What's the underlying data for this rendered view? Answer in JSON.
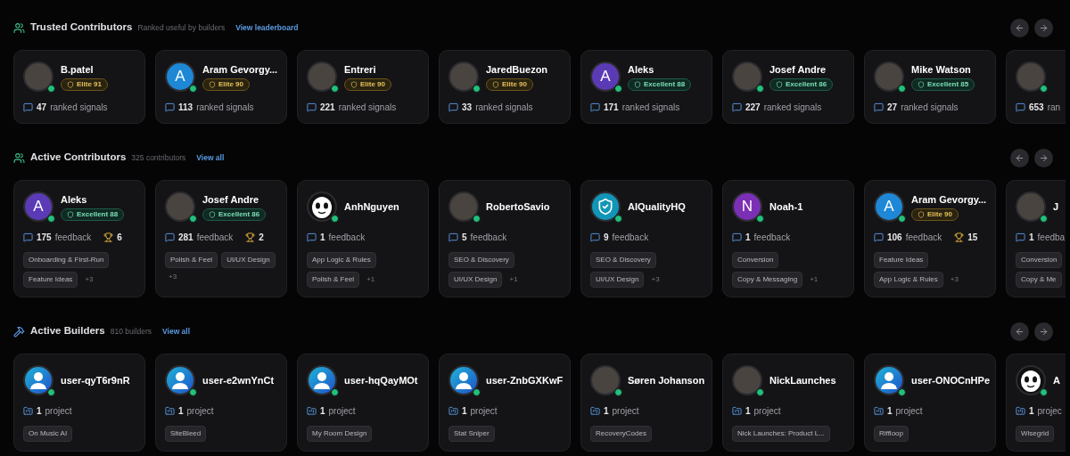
{
  "sections": [
    {
      "title": "Trusted Contributors",
      "subtitle": "Ranked useful by builders",
      "link": "View leaderboard",
      "cards": [
        {
          "name": "B.patel",
          "avatar": {
            "kind": "photo"
          },
          "online": true,
          "badge": {
            "kind": "elite",
            "label": "Elite 91"
          },
          "stats": [
            {
              "kind": "comments",
              "value": "47",
              "label": "ranked signals"
            }
          ]
        },
        {
          "name": "Aram Gevorgy...",
          "avatar": {
            "kind": "letter",
            "letter": "A",
            "color": "#1e88d6"
          },
          "online": true,
          "badge": {
            "kind": "elite",
            "label": "Elite 90"
          },
          "stats": [
            {
              "kind": "comments",
              "value": "113",
              "label": "ranked signals"
            }
          ]
        },
        {
          "name": "Entreri",
          "avatar": {
            "kind": "photo"
          },
          "online": true,
          "badge": {
            "kind": "elite",
            "label": "Elite 90"
          },
          "stats": [
            {
              "kind": "comments",
              "value": "221",
              "label": "ranked signals"
            }
          ]
        },
        {
          "name": "JaredBuezon",
          "avatar": {
            "kind": "photo"
          },
          "online": true,
          "badge": {
            "kind": "elite",
            "label": "Elite 90"
          },
          "stats": [
            {
              "kind": "comments",
              "value": "33",
              "label": "ranked signals"
            }
          ]
        },
        {
          "name": "Aleks",
          "avatar": {
            "kind": "letter",
            "letter": "A",
            "color": "#5b3bb5"
          },
          "online": true,
          "badge": {
            "kind": "excellent",
            "label": "Excellent 88"
          },
          "stats": [
            {
              "kind": "comments",
              "value": "171",
              "label": "ranked signals"
            }
          ]
        },
        {
          "name": "Josef Andre",
          "avatar": {
            "kind": "photo"
          },
          "online": true,
          "badge": {
            "kind": "excellent",
            "label": "Excellent 86"
          },
          "stats": [
            {
              "kind": "comments",
              "value": "227",
              "label": "ranked signals"
            }
          ]
        },
        {
          "name": "Mike Watson",
          "avatar": {
            "kind": "photo"
          },
          "online": true,
          "badge": {
            "kind": "excellent",
            "label": "Excellent 85"
          },
          "stats": [
            {
              "kind": "comments",
              "value": "27",
              "label": "ranked signals"
            }
          ]
        },
        {
          "avatar": {
            "kind": "photo"
          },
          "online": true,
          "stats": [
            {
              "kind": "comments",
              "value": "653",
              "label": "ran"
            }
          ]
        }
      ]
    },
    {
      "title": "Active Contributors",
      "subtitle": "325 contributors",
      "link": "View all",
      "cards": [
        {
          "name": "Aleks",
          "avatar": {
            "kind": "letter",
            "letter": "A",
            "color": "#5b3bb5"
          },
          "online": true,
          "badge": {
            "kind": "excellent",
            "label": "Excellent 88"
          },
          "stats": [
            {
              "kind": "comments",
              "value": "175",
              "label": "feedback"
            },
            {
              "kind": "trophy",
              "value": "6"
            }
          ],
          "tags": [
            "Onboarding & First-Run",
            "Feature Ideas"
          ],
          "more": "+3"
        },
        {
          "name": "Josef Andre",
          "avatar": {
            "kind": "photo"
          },
          "online": true,
          "badge": {
            "kind": "excellent",
            "label": "Excellent 86"
          },
          "stats": [
            {
              "kind": "comments",
              "value": "281",
              "label": "feedback"
            },
            {
              "kind": "trophy",
              "value": "2"
            }
          ],
          "tags": [
            "Polish & Feel",
            "UI/UX Design"
          ],
          "more": "+3"
        },
        {
          "name": "AnhNguyen",
          "avatar": {
            "kind": "panda"
          },
          "online": true,
          "stats": [
            {
              "kind": "comments",
              "value": "1",
              "label": "feedback"
            }
          ],
          "tags": [
            "App Logic & Rules",
            "Polish & Feel"
          ],
          "more": "+1"
        },
        {
          "name": "RobertoSavio",
          "avatar": {
            "kind": "photo"
          },
          "online": true,
          "stats": [
            {
              "kind": "comments",
              "value": "5",
              "label": "feedback"
            }
          ],
          "tags": [
            "SEO & Discovery",
            "UI/UX Design"
          ],
          "more": "+1"
        },
        {
          "name": "AIQualityHQ",
          "avatar": {
            "kind": "shield"
          },
          "online": true,
          "stats": [
            {
              "kind": "comments",
              "value": "9",
              "label": "feedback"
            }
          ],
          "tags": [
            "SEO & Discovery",
            "UI/UX Design"
          ],
          "more": "+3"
        },
        {
          "name": "Noah-1",
          "avatar": {
            "kind": "letter",
            "letter": "N",
            "color": "#7b2fb5"
          },
          "online": true,
          "stats": [
            {
              "kind": "comments",
              "value": "1",
              "label": "feedback"
            }
          ],
          "tags": [
            "Conversion",
            "Copy & Messaging"
          ],
          "more": "+1"
        },
        {
          "name": "Aram Gevorgy...",
          "avatar": {
            "kind": "letter",
            "letter": "A",
            "color": "#1e88d6"
          },
          "online": true,
          "badge": {
            "kind": "elite",
            "label": "Elite 90"
          },
          "stats": [
            {
              "kind": "comments",
              "value": "106",
              "label": "feedback"
            },
            {
              "kind": "trophy",
              "value": "15"
            }
          ],
          "tags": [
            "Feature Ideas",
            "App Logic & Rules"
          ],
          "more": "+3"
        },
        {
          "name": "J",
          "avatar": {
            "kind": "photo"
          },
          "online": true,
          "stats": [
            {
              "kind": "comments",
              "value": "1",
              "label": "feedba"
            }
          ],
          "tags": [
            "Conversion",
            "Copy & Me"
          ]
        }
      ]
    },
    {
      "title": "Active Builders",
      "subtitle": "810 builders",
      "link": "View all",
      "cards": [
        {
          "name": "user-qyT6r9nR",
          "avatar": {
            "kind": "silhouette"
          },
          "online": true,
          "stats": [
            {
              "kind": "projects",
              "value": "1",
              "label": "project"
            }
          ],
          "tags": [
            "On Music AI"
          ]
        },
        {
          "name": "user-e2wnYnCt",
          "avatar": {
            "kind": "silhouette"
          },
          "online": true,
          "stats": [
            {
              "kind": "projects",
              "value": "1",
              "label": "project"
            }
          ],
          "tags": [
            "SiteBleed"
          ]
        },
        {
          "name": "user-hqQayMOt",
          "avatar": {
            "kind": "silhouette"
          },
          "online": true,
          "stats": [
            {
              "kind": "projects",
              "value": "1",
              "label": "project"
            }
          ],
          "tags": [
            "My Room Design"
          ]
        },
        {
          "name": "user-ZnbGXKwF",
          "avatar": {
            "kind": "silhouette"
          },
          "online": true,
          "stats": [
            {
              "kind": "projects",
              "value": "1",
              "label": "project"
            }
          ],
          "tags": [
            "Stat Sniper"
          ]
        },
        {
          "name": "Søren Johanson",
          "avatar": {
            "kind": "photo"
          },
          "online": true,
          "stats": [
            {
              "kind": "projects",
              "value": "1",
              "label": "project"
            }
          ],
          "tags": [
            "RecoveryCodes"
          ]
        },
        {
          "name": "NickLaunches",
          "avatar": {
            "kind": "photo"
          },
          "online": true,
          "stats": [
            {
              "kind": "projects",
              "value": "1",
              "label": "project"
            }
          ],
          "tags": [
            "Nick Launches: Product L..."
          ]
        },
        {
          "name": "user-ONOCnHPe",
          "avatar": {
            "kind": "silhouette"
          },
          "online": true,
          "stats": [
            {
              "kind": "projects",
              "value": "1",
              "label": "project"
            }
          ],
          "tags": [
            "Riffloop"
          ]
        },
        {
          "name": "A",
          "avatar": {
            "kind": "panda"
          },
          "online": true,
          "stats": [
            {
              "kind": "projects",
              "value": "1",
              "label": "projec"
            }
          ],
          "tags": [
            "Wisegrid"
          ]
        }
      ]
    }
  ]
}
